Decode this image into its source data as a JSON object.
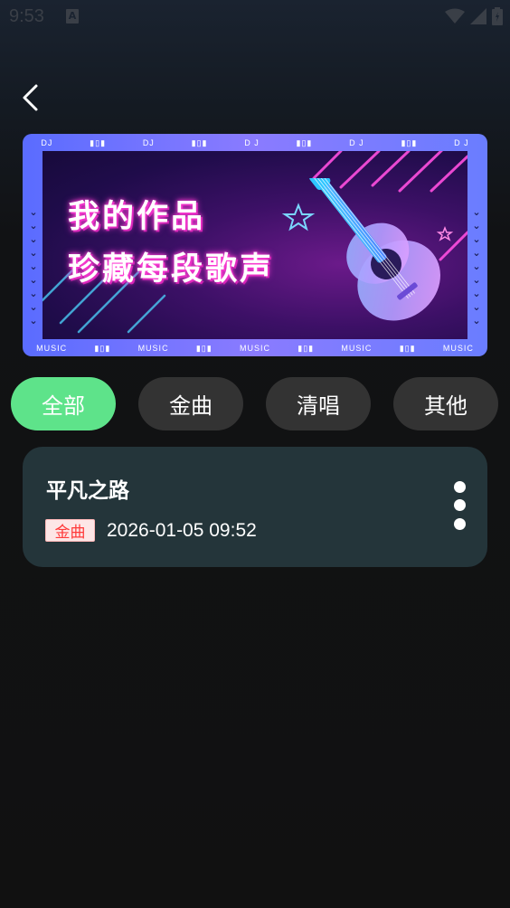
{
  "status_bar": {
    "time": "9:53",
    "notification_icon": "a-icon",
    "icons": [
      "wifi-icon",
      "signal-icon",
      "battery-icon"
    ]
  },
  "header": {
    "back_icon": "chevron-left-icon"
  },
  "banner": {
    "line1": "我的作品",
    "line2": "珍藏每段歌声",
    "top_strip": [
      "DJ",
      "DJ",
      "D J",
      "D J",
      "D J"
    ],
    "bottom_strip": [
      "MUSIC",
      "MUSIC",
      "MUSIC",
      "MUSIC",
      "MUSIC"
    ]
  },
  "tabs": [
    {
      "label": "全部",
      "active": true
    },
    {
      "label": "金曲",
      "active": false
    },
    {
      "label": "清唱",
      "active": false
    },
    {
      "label": "其他",
      "active": false
    }
  ],
  "works": [
    {
      "title": "平凡之路",
      "tag": "金曲",
      "datetime": "2026-01-05 09:52",
      "more_icon": "more-vertical-icon"
    }
  ],
  "colors": {
    "tab_active": "#5ee38a",
    "tab_inactive": "#333333",
    "card_bg": "#24353a",
    "tag_text": "#ff3a3a",
    "tag_bg": "#fde6e6"
  }
}
